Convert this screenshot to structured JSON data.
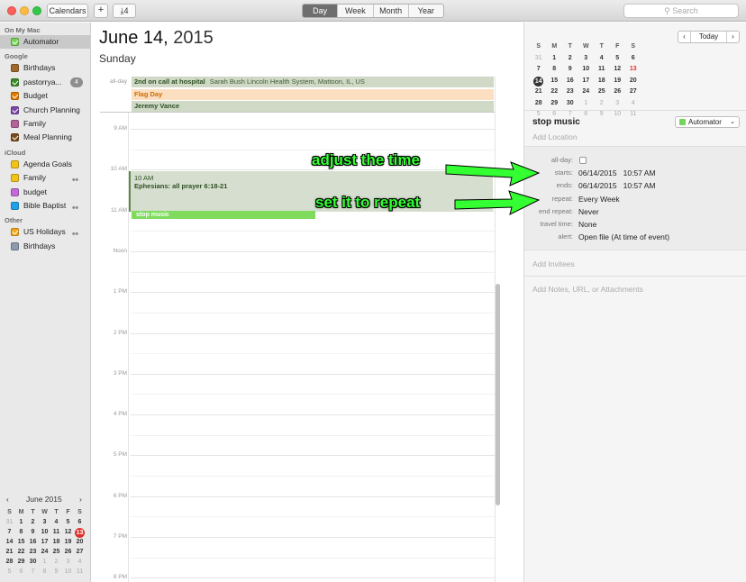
{
  "toolbar": {
    "calendars_label": "Calendars",
    "add_label": "+",
    "download_label": "4",
    "views": [
      "Day",
      "Week",
      "Month",
      "Year"
    ],
    "selected_view": "Day",
    "search_placeholder": "Search"
  },
  "sidebar": {
    "sections": [
      {
        "title": "On My Mac",
        "items": [
          {
            "label": "Automator",
            "color": "#77d45a",
            "checked": true,
            "selected": true
          }
        ]
      },
      {
        "title": "Google",
        "items": [
          {
            "label": "Birthdays",
            "color": "#a0692b",
            "checked": false
          },
          {
            "label": "pastorrya...",
            "color": "#3a8c2a",
            "checked": true,
            "badge": "4"
          },
          {
            "label": "Budget",
            "color": "#e07b00",
            "checked": true
          },
          {
            "label": "Church Planning",
            "color": "#7a47a8",
            "checked": true
          },
          {
            "label": "Family",
            "color": "#b2649a",
            "checked": false
          },
          {
            "label": "Meal Planning",
            "color": "#7b4a1c",
            "checked": true
          }
        ]
      },
      {
        "title": "iCloud",
        "items": [
          {
            "label": "Agenda Goals",
            "color": "#f2c41a",
            "checked": false
          },
          {
            "label": "Family",
            "color": "#f2c41a",
            "checked": false,
            "shared": true
          },
          {
            "label": "budget",
            "color": "#c36ad6",
            "checked": false
          },
          {
            "label": "Bible Baptist",
            "color": "#1fa2e8",
            "checked": false,
            "shared": true
          }
        ]
      },
      {
        "title": "Other",
        "items": [
          {
            "label": "US Holidays",
            "color": "#f2a81d",
            "checked": true,
            "shared": true
          },
          {
            "label": "Birthdays",
            "color": "#8e9ab0",
            "checked": false
          }
        ]
      }
    ]
  },
  "mini_calendar": {
    "month_label": "June 2015",
    "weekdays": [
      "S",
      "M",
      "T",
      "W",
      "T",
      "F",
      "S"
    ],
    "days": [
      "31",
      "1",
      "2",
      "3",
      "4",
      "5",
      "6",
      "7",
      "8",
      "9",
      "10",
      "11",
      "12",
      "13",
      "14",
      "15",
      "16",
      "17",
      "18",
      "19",
      "20",
      "21",
      "22",
      "23",
      "24",
      "25",
      "26",
      "27",
      "28",
      "29",
      "30",
      "1",
      "2",
      "3",
      "4",
      "5",
      "6",
      "7",
      "8",
      "9",
      "10",
      "11"
    ],
    "today": "13"
  },
  "day_view": {
    "date_strong": "June 14,",
    "date_year": "2015",
    "weekday": "Sunday",
    "all_day_label": "all-day",
    "all_day_events": [
      {
        "title": "2nd on call at hospital",
        "detail": "Sarah Bush Lincoln Health System, Mattoon, IL, US",
        "bg": "#cfd9c6",
        "fg": "#2d4f22"
      },
      {
        "title": "Flag Day",
        "detail": "",
        "bg": "#fbdfc0",
        "fg": "#d06a00"
      },
      {
        "title": "Jeremy Vance",
        "detail": "",
        "bg": "#cfd9c6",
        "fg": "#2d4f22"
      }
    ],
    "hours": [
      "9 AM",
      "10 AM",
      "11 AM",
      "Noon",
      "1 PM",
      "2 PM",
      "3 PM",
      "4 PM",
      "5 PM",
      "6 PM",
      "7 PM",
      "8 PM"
    ],
    "events": [
      {
        "time": "10 AM",
        "title": "Ephesians: all prayer 6:18-21",
        "bg": "#d6dfcf",
        "fg": "#2d4f22"
      },
      {
        "time": "",
        "title": "stop music",
        "bg": "#7edb5c",
        "fg": "#ffffff"
      }
    ]
  },
  "right_mini": {
    "weekdays": [
      "S",
      "M",
      "T",
      "W",
      "T",
      "F",
      "S"
    ],
    "days": [
      "31",
      "1",
      "2",
      "3",
      "4",
      "5",
      "6",
      "7",
      "8",
      "9",
      "10",
      "11",
      "12",
      "13",
      "14",
      "15",
      "16",
      "17",
      "18",
      "19",
      "20",
      "21",
      "22",
      "23",
      "24",
      "25",
      "26",
      "27",
      "28",
      "29",
      "30",
      "1",
      "2",
      "3",
      "4",
      "5",
      "6",
      "7",
      "8",
      "9",
      "10",
      "11"
    ],
    "selected": "14",
    "today": "13",
    "today_button": "Today"
  },
  "inspector": {
    "title": "stop music",
    "calendar": "Automator",
    "location_placeholder": "Add Location",
    "fields": [
      {
        "key": "all-day:",
        "value": ""
      },
      {
        "key": "starts:",
        "value": "06/14/2015   10:57 AM"
      },
      {
        "key": "ends:",
        "value": "06/14/2015   10:57 AM"
      },
      {
        "key": "repeat:",
        "value": "Every Week"
      },
      {
        "key": "end repeat:",
        "value": "Never"
      },
      {
        "key": "travel time:",
        "value": "None"
      },
      {
        "key": "alert:",
        "value": "Open file (At time of event)"
      }
    ],
    "invitees_placeholder": "Add Invitees",
    "notes_placeholder": "Add Notes, URL, or Attachments"
  },
  "annotations": [
    {
      "text": "adjust the time"
    },
    {
      "text": "set it to repeat"
    }
  ],
  "colors": {
    "annotation": "#33ff33",
    "today_red": "#e0302a"
  }
}
